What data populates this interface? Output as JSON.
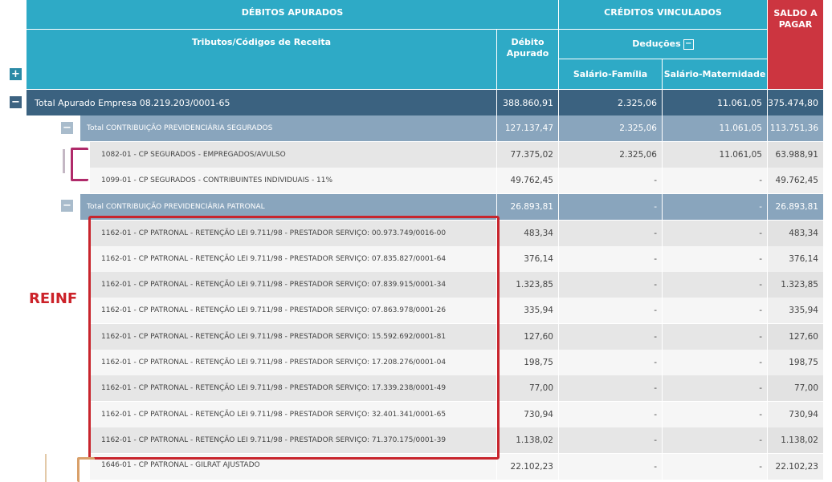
{
  "header": {
    "debitos_apurados": "DÉBITOS APURADOS",
    "creditos_vinculados": "CRÉDITOS VINCULADOS",
    "saldo_a_pagar": "SALDO A PAGAR",
    "tributos_codigos": "Tributos/Códigos de Receita",
    "debito_apurado": "Débito Apurado",
    "deducoes": "Deduções",
    "salario_familia": "Salário-Família",
    "salario_maternidade": "Salário-Maternidade"
  },
  "annotation": {
    "label": "REINF"
  },
  "total": {
    "label": "Total Apurado Empresa 08.219.203/0001-65",
    "debito": "388.860,91",
    "salario_familia": "2.325,06",
    "salario_maternidade": "11.061,05",
    "saldo": "375.474,80"
  },
  "groups": [
    {
      "label": "Total CONTRIBUIÇÃO PREVIDENCIÁRIA SEGURADOS",
      "debito": "127.137,47",
      "salario_familia": "2.325,06",
      "salario_maternidade": "11.061,05",
      "saldo": "113.751,36",
      "rows": [
        {
          "label": "1082-01 - CP SEGURADOS - EMPREGADOS/AVULSO",
          "debito": "77.375,02",
          "salario_familia": "2.325,06",
          "salario_maternidade": "11.061,05",
          "saldo": "63.988,91"
        },
        {
          "label": "1099-01 - CP SEGURADOS - CONTRIBUINTES INDIVIDUAIS - 11%",
          "debito": "49.762,45",
          "salario_familia": "-",
          "salario_maternidade": "-",
          "saldo": "49.762,45"
        }
      ]
    },
    {
      "label": "Total CONTRIBUIÇÃO PREVIDENCIÁRIA PATRONAL",
      "debito": "26.893,81",
      "salario_familia": "-",
      "salario_maternidade": "-",
      "saldo": "26.893,81",
      "rows": [
        {
          "label": "1162-01 - CP PATRONAL - RETENÇÃO LEI 9.711/98 - PRESTADOR SERVIÇO: 00.973.749/0016-00",
          "debito": "483,34",
          "salario_familia": "-",
          "salario_maternidade": "-",
          "saldo": "483,34"
        },
        {
          "label": "1162-01 - CP PATRONAL - RETENÇÃO LEI 9.711/98 - PRESTADOR SERVIÇO: 07.835.827/0001-64",
          "debito": "376,14",
          "salario_familia": "-",
          "salario_maternidade": "-",
          "saldo": "376,14"
        },
        {
          "label": "1162-01 - CP PATRONAL - RETENÇÃO LEI 9.711/98 - PRESTADOR SERVIÇO: 07.839.915/0001-34",
          "debito": "1.323,85",
          "salario_familia": "-",
          "salario_maternidade": "-",
          "saldo": "1.323,85"
        },
        {
          "label": "1162-01 - CP PATRONAL - RETENÇÃO LEI 9.711/98 - PRESTADOR SERVIÇO: 07.863.978/0001-26",
          "debito": "335,94",
          "salario_familia": "-",
          "salario_maternidade": "-",
          "saldo": "335,94"
        },
        {
          "label": "1162-01 - CP PATRONAL - RETENÇÃO LEI 9.711/98 - PRESTADOR SERVIÇO: 15.592.692/0001-81",
          "debito": "127,60",
          "salario_familia": "-",
          "salario_maternidade": "-",
          "saldo": "127,60"
        },
        {
          "label": "1162-01 - CP PATRONAL - RETENÇÃO LEI 9.711/98 - PRESTADOR SERVIÇO: 17.208.276/0001-04",
          "debito": "198,75",
          "salario_familia": "-",
          "salario_maternidade": "-",
          "saldo": "198,75"
        },
        {
          "label": "1162-01 - CP PATRONAL - RETENÇÃO LEI 9.711/98 - PRESTADOR SERVIÇO: 17.339.238/0001-49",
          "debito": "77,00",
          "salario_familia": "-",
          "salario_maternidade": "-",
          "saldo": "77,00"
        },
        {
          "label": "1162-01 - CP PATRONAL - RETENÇÃO LEI 9.711/98 - PRESTADOR SERVIÇO: 32.401.341/0001-65",
          "debito": "730,94",
          "salario_familia": "-",
          "salario_maternidade": "-",
          "saldo": "730,94"
        },
        {
          "label": "1162-01 - CP PATRONAL - RETENÇÃO LEI 9.711/98 - PRESTADOR SERVIÇO: 71.370.175/0001-39",
          "debito": "1.138,02",
          "salario_familia": "-",
          "salario_maternidade": "-",
          "saldo": "1.138,02"
        },
        {
          "label": "1646-01 - CP PATRONAL - GILRAT AJUSTADO",
          "debito": "22.102,23",
          "salario_familia": "-",
          "salario_maternidade": "-",
          "saldo": "22.102,23"
        }
      ]
    }
  ]
}
